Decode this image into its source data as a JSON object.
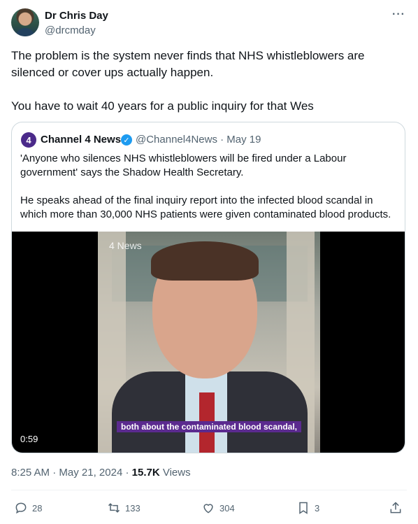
{
  "author": {
    "name": "Dr Chris Day",
    "handle": "@drcmday"
  },
  "tweet": {
    "paragraphs": [
      "The problem is the system never finds that NHS whistleblowers are silenced or cover ups actually happen.",
      "You have to wait 40 years for a public inquiry for that Wes"
    ]
  },
  "quote": {
    "logo_glyph": "4",
    "name": "Channel 4 News",
    "handle": "@Channel4News",
    "date_sep": "·",
    "date": "May 19",
    "paragraphs": [
      "'Anyone who silences NHS whistleblowers will be fired under a Labour government' says the Shadow Health Secretary.",
      "He speaks ahead of the final inquiry report into the infected blood scandal in which more than 30,000 NHS patients were given contaminated blood products."
    ],
    "video": {
      "watermark": "4 News",
      "caption": "both about the contaminated blood scandal,",
      "duration": "0:59"
    }
  },
  "meta": {
    "time": "8:25 AM",
    "date": "May 21, 2024",
    "views_count": "15.7K",
    "views_label": "Views"
  },
  "actions": {
    "replies": "28",
    "reposts": "133",
    "likes": "304",
    "bookmarks": "3"
  }
}
